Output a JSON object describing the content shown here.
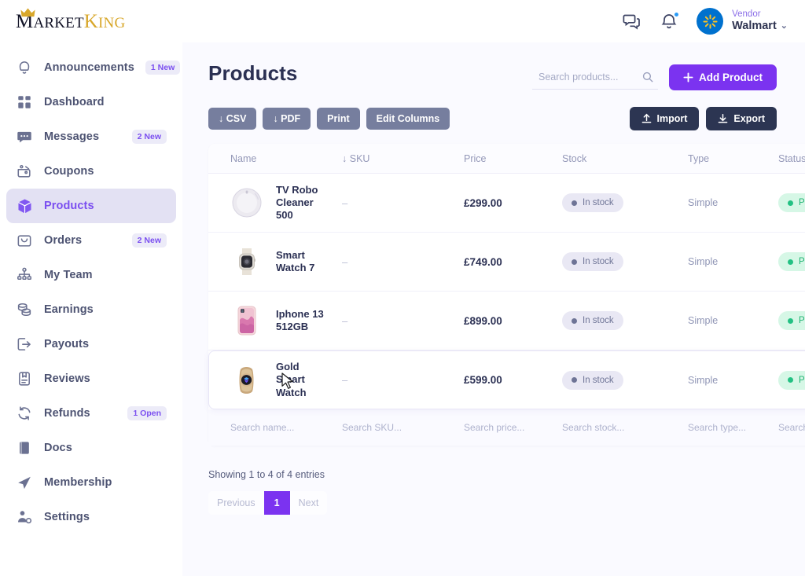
{
  "brand": {
    "name_part1": "M",
    "name_part1b": "ARKET",
    "name_part2": "K",
    "name_part2b": "ING"
  },
  "header": {
    "messages_icon": "chat-bubbles-icon",
    "notifications_icon": "bell-icon",
    "avatar_icon": "walmart-spark-icon",
    "user_role": "Vendor",
    "user_name": "Walmart",
    "chevron": "⌄"
  },
  "sidebar": {
    "items": [
      {
        "label": "Announcements",
        "icon": "bell-icon",
        "badge": "1 New",
        "active": false
      },
      {
        "label": "Dashboard",
        "icon": "grid-icon",
        "badge": "",
        "active": false
      },
      {
        "label": "Messages",
        "icon": "chat-icon",
        "badge": "2 New",
        "active": false
      },
      {
        "label": "Coupons",
        "icon": "coupon-icon",
        "badge": "",
        "active": false
      },
      {
        "label": "Products",
        "icon": "box-icon",
        "badge": "",
        "active": true
      },
      {
        "label": "Orders",
        "icon": "bag-icon",
        "badge": "2 New",
        "active": false
      },
      {
        "label": "My Team",
        "icon": "team-icon",
        "badge": "",
        "active": false
      },
      {
        "label": "Earnings",
        "icon": "coins-icon",
        "badge": "",
        "active": false
      },
      {
        "label": "Payouts",
        "icon": "payout-icon",
        "badge": "",
        "active": false
      },
      {
        "label": "Reviews",
        "icon": "review-icon",
        "badge": "",
        "active": false
      },
      {
        "label": "Refunds",
        "icon": "refresh-icon",
        "badge": "1 Open",
        "active": false
      },
      {
        "label": "Docs",
        "icon": "book-icon",
        "badge": "",
        "active": false
      },
      {
        "label": "Membership",
        "icon": "send-icon",
        "badge": "",
        "active": false
      },
      {
        "label": "Settings",
        "icon": "user-gear-icon",
        "badge": "",
        "active": false
      }
    ]
  },
  "main": {
    "title": "Products",
    "search_placeholder": "Search products...",
    "search_value": "",
    "search_icon": "search-icon",
    "add_product_label": "Add Product",
    "add_product_icon": "plus-icon",
    "toolbar": [
      {
        "label": "↓ CSV"
      },
      {
        "label": "↓ PDF"
      },
      {
        "label": "Print"
      },
      {
        "label": "Edit Columns"
      }
    ],
    "import_label": "Import",
    "import_icon": "upload-icon",
    "export_label": "Export",
    "export_icon": "download-icon",
    "columns": [
      {
        "label": "Name",
        "sort": ""
      },
      {
        "label": "SKU",
        "sort": "↓"
      },
      {
        "label": "Price",
        "sort": ""
      },
      {
        "label": "Stock",
        "sort": ""
      },
      {
        "label": "Type",
        "sort": ""
      },
      {
        "label": "Status",
        "sort": ""
      }
    ],
    "rows": [
      {
        "name": "TV Robo Cleaner 500",
        "thumb": "robot-vacuum-thumbnail",
        "sku": "–",
        "price": "£299.00",
        "stock": "In stock",
        "type": "Simple",
        "status": "Publish",
        "hovered": false
      },
      {
        "name": "Smart Watch 7",
        "thumb": "silver-smartwatch-thumbnail",
        "sku": "–",
        "price": "£749.00",
        "stock": "In stock",
        "type": "Simple",
        "status": "Publish",
        "hovered": false
      },
      {
        "name": "Iphone 13 512GB",
        "thumb": "pink-iphone-thumbnail",
        "sku": "–",
        "price": "£899.00",
        "stock": "In stock",
        "type": "Simple",
        "status": "Publish",
        "hovered": false
      },
      {
        "name": "Gold Smart Watch",
        "thumb": "gold-smartwatch-thumbnail",
        "sku": "–",
        "price": "£599.00",
        "stock": "In stock",
        "type": "Simple",
        "status": "Publish",
        "hovered": true
      }
    ],
    "filters": [
      {
        "placeholder": "Search name..."
      },
      {
        "placeholder": "Search SKU..."
      },
      {
        "placeholder": "Search price..."
      },
      {
        "placeholder": "Search stock..."
      },
      {
        "placeholder": "Search type..."
      },
      {
        "placeholder": "Search status..."
      }
    ],
    "showing_text": "Showing 1 to 4 of 4 entries",
    "pagination": {
      "previous": "Previous",
      "page": "1",
      "next": "Next"
    }
  },
  "colors": {
    "accent_purple": "#7b33f0",
    "accent_light": "#e3e1f3",
    "dark_navy": "#2c3552",
    "grey_button": "#767e9e",
    "green_status": "#23c183",
    "walmart_blue": "#0071ce",
    "gold": "#d8a72a"
  }
}
